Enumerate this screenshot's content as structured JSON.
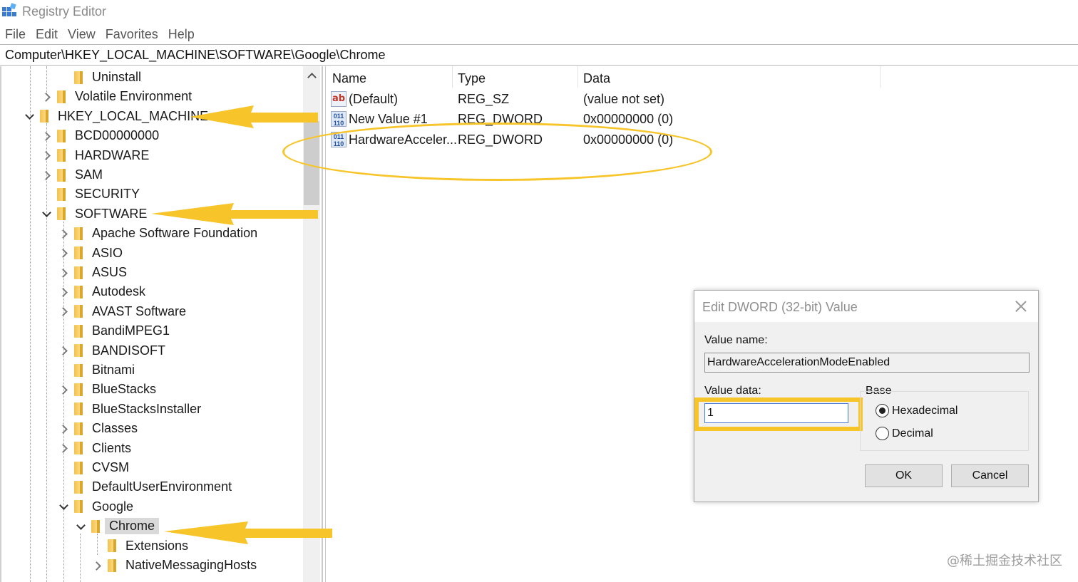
{
  "window": {
    "title": "Registry Editor"
  },
  "menu": [
    "File",
    "Edit",
    "View",
    "Favorites",
    "Help"
  ],
  "address": "Computer\\HKEY_LOCAL_MACHINE\\SOFTWARE\\Google\\Chrome",
  "tree": [
    {
      "label": "Uninstall",
      "expander": "none"
    },
    {
      "label": "Volatile Environment",
      "expander": "collapsed"
    },
    {
      "label": "HKEY_LOCAL_MACHINE",
      "expander": "expanded"
    },
    {
      "label": "BCD00000000",
      "expander": "collapsed"
    },
    {
      "label": "HARDWARE",
      "expander": "collapsed"
    },
    {
      "label": "SAM",
      "expander": "collapsed"
    },
    {
      "label": "SECURITY",
      "expander": "none"
    },
    {
      "label": "SOFTWARE",
      "expander": "expanded"
    },
    {
      "label": "Apache Software Foundation",
      "expander": "collapsed"
    },
    {
      "label": "ASIO",
      "expander": "collapsed"
    },
    {
      "label": "ASUS",
      "expander": "collapsed"
    },
    {
      "label": "Autodesk",
      "expander": "collapsed"
    },
    {
      "label": "AVAST Software",
      "expander": "collapsed"
    },
    {
      "label": "BandiMPEG1",
      "expander": "none"
    },
    {
      "label": "BANDISOFT",
      "expander": "collapsed"
    },
    {
      "label": "Bitnami",
      "expander": "none"
    },
    {
      "label": "BlueStacks",
      "expander": "collapsed"
    },
    {
      "label": "BlueStacksInstaller",
      "expander": "none"
    },
    {
      "label": "Classes",
      "expander": "collapsed"
    },
    {
      "label": "Clients",
      "expander": "collapsed"
    },
    {
      "label": "CVSM",
      "expander": "none"
    },
    {
      "label": "DefaultUserEnvironment",
      "expander": "none"
    },
    {
      "label": "Google",
      "expander": "expanded"
    },
    {
      "label": "Chrome",
      "expander": "expanded",
      "selected": true
    },
    {
      "label": "Extensions",
      "expander": "none"
    },
    {
      "label": "NativeMessagingHosts",
      "expander": "collapsed"
    }
  ],
  "columns": {
    "name": "Name",
    "type": "Type",
    "data": "Data"
  },
  "values": [
    {
      "icon": "string-value-icon",
      "name": "(Default)",
      "type": "REG_SZ",
      "data": "(value not set)"
    },
    {
      "icon": "dword-value-icon",
      "name": "New Value #1",
      "type": "REG_DWORD",
      "data": "0x00000000 (0)"
    },
    {
      "icon": "dword-value-icon",
      "name": "HardwareAcceler...",
      "type": "REG_DWORD",
      "data": "0x00000000 (0)"
    }
  ],
  "dialog": {
    "title": "Edit DWORD (32-bit) Value",
    "value_name_label": "Value name:",
    "value_name": "HardwareAccelerationModeEnabled",
    "value_data_label": "Value data:",
    "value_data": "1",
    "base_label": "Base",
    "hex_label": "Hexadecimal",
    "dec_label": "Decimal",
    "base_selected": "Hexadecimal",
    "ok_label": "OK",
    "cancel_label": "Cancel"
  },
  "watermark": "@稀土掘金技术社区",
  "colors": {
    "annotation": "#f7c52a",
    "selection": "#d9d9d9",
    "folder": "#f3c34b"
  }
}
